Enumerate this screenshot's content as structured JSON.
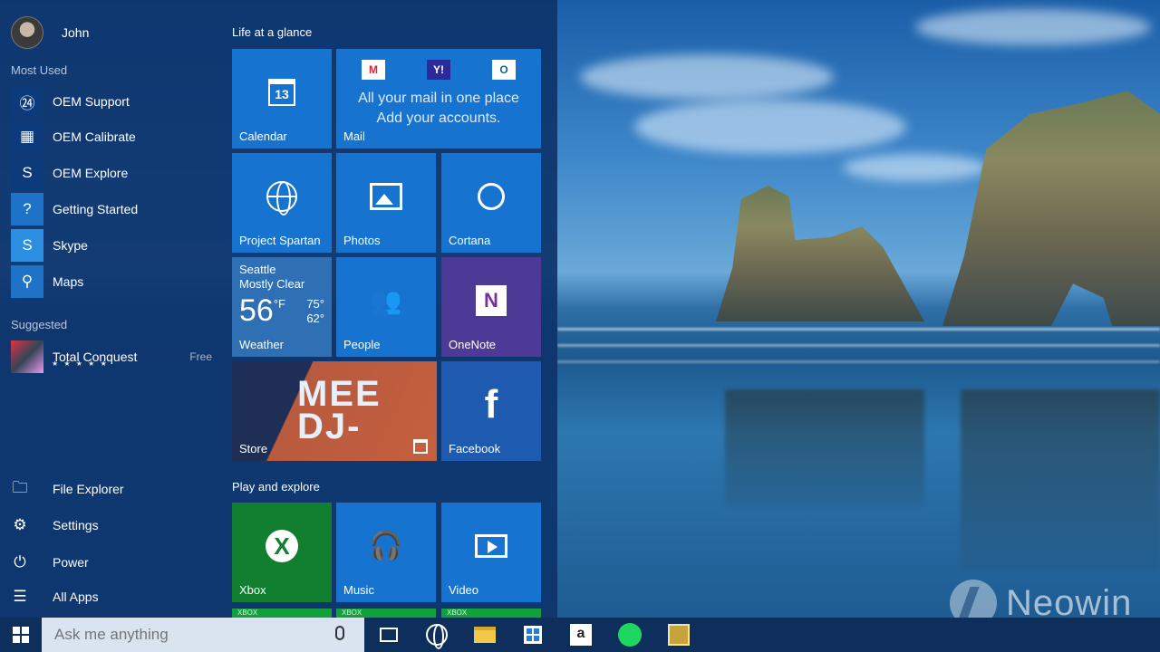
{
  "user": {
    "name": "John"
  },
  "left_pane": {
    "most_used_label": "Most Used",
    "most_used": [
      {
        "label": "OEM Support",
        "icon": "headset-24-icon",
        "glyph": "㉔"
      },
      {
        "label": "OEM Calibrate",
        "icon": "calibrate-grid-icon",
        "glyph": "▦"
      },
      {
        "label": "OEM Explore",
        "icon": "explore-s-icon",
        "glyph": "S"
      },
      {
        "label": "Getting Started",
        "icon": "question-icon",
        "glyph": "?"
      },
      {
        "label": "Skype",
        "icon": "skype-icon",
        "glyph": "S"
      },
      {
        "label": "Maps",
        "icon": "map-pin-icon",
        "glyph": "⚲"
      }
    ],
    "suggested_label": "Suggested",
    "suggested": {
      "label": "Total Conquest",
      "price": "Free",
      "rating": "★ ★ ★ ★ ★"
    },
    "bottom": [
      {
        "label": "File Explorer",
        "icon": "folder-icon",
        "glyph": "🗀"
      },
      {
        "label": "Settings",
        "icon": "gear-icon",
        "glyph": "⚙"
      },
      {
        "label": "Power",
        "icon": "power-icon",
        "glyph": "⏻"
      },
      {
        "label": "All Apps",
        "icon": "list-icon",
        "glyph": "☰"
      }
    ]
  },
  "groups": {
    "life": "Life at a glance",
    "play": "Play and explore"
  },
  "tiles": {
    "calendar": {
      "label": "Calendar",
      "day": "13"
    },
    "mail": {
      "label": "Mail",
      "line1": "All your mail in one place",
      "line2": "Add your accounts.",
      "icons": [
        "M",
        "Y!",
        "O"
      ]
    },
    "spartan": {
      "label": "Project Spartan"
    },
    "photos": {
      "label": "Photos"
    },
    "cortana": {
      "label": "Cortana"
    },
    "weather": {
      "label": "Weather",
      "city": "Seattle",
      "condition": "Mostly Clear",
      "temp": "56",
      "unit": "°F",
      "high": "75°",
      "low": "62°"
    },
    "people": {
      "label": "People"
    },
    "onenote": {
      "label": "OneNote",
      "glyph": "N"
    },
    "store": {
      "label": "Store",
      "art_text_1": "MEE",
      "art_text_2": "DJ-"
    },
    "facebook": {
      "label": "Facebook",
      "glyph": "f"
    },
    "xbox": {
      "label": "Xbox",
      "glyph": "X"
    },
    "music": {
      "label": "Music",
      "glyph": "🎧"
    },
    "video": {
      "label": "Video"
    },
    "peek_1": "XBOX",
    "peek_2": "XBOX",
    "peek_3": "XBOX"
  },
  "taskbar": {
    "search_placeholder": "Ask me anything",
    "amazon_glyph": "a"
  },
  "watermark": "Neowin",
  "colors": {
    "tile_blue": "#1674d0",
    "onenote_purple": "#7a2fa0",
    "xbox_green": "#127e2f",
    "store_orange": "#c4603e",
    "taskbar": "#0e2f5c"
  }
}
